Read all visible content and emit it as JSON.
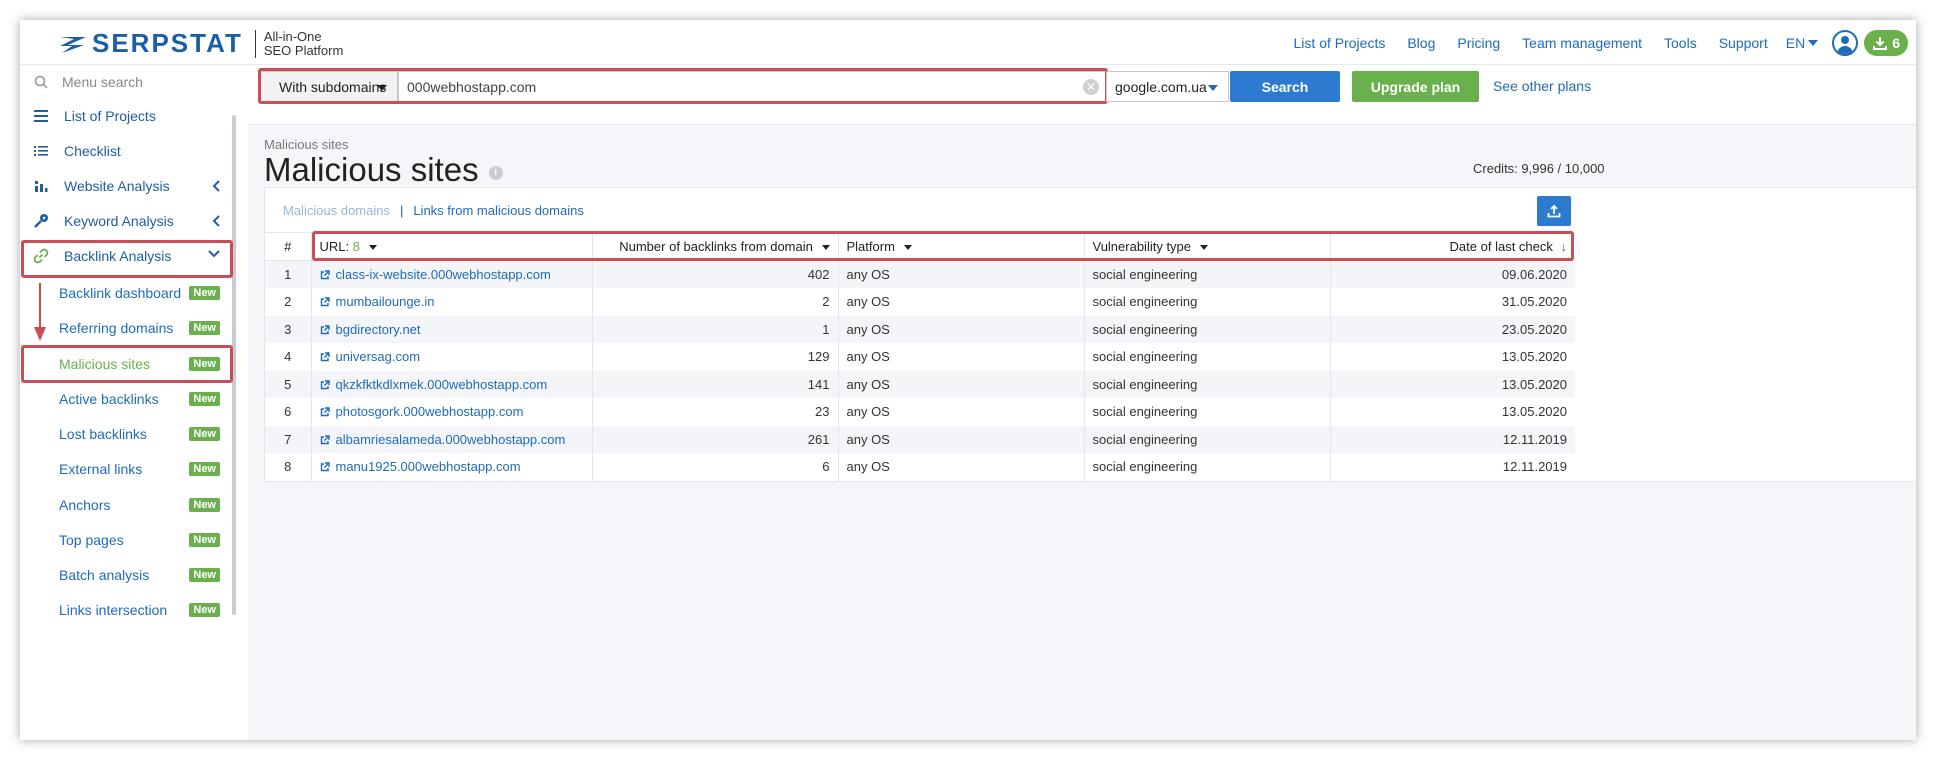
{
  "header": {
    "logo_text": "SERPSTAT",
    "tagline_1": "All-in-One",
    "tagline_2": "SEO Platform",
    "nav": [
      "List of Projects",
      "Blog",
      "Pricing",
      "Team management",
      "Tools",
      "Support"
    ],
    "lang": "EN",
    "downloads_count": "6"
  },
  "sidebar": {
    "search_placeholder": "Menu search",
    "items": [
      {
        "label": "List of Projects"
      },
      {
        "label": "Checklist"
      },
      {
        "label": "Website Analysis"
      },
      {
        "label": "Keyword Analysis"
      },
      {
        "label": "Backlink Analysis"
      }
    ],
    "sub_items": [
      {
        "label": "Backlink dashboard",
        "badge": "New"
      },
      {
        "label": "Referring domains",
        "badge": "New"
      },
      {
        "label": "Malicious sites",
        "badge": "New"
      },
      {
        "label": "Active backlinks",
        "badge": "New"
      },
      {
        "label": "Lost backlinks",
        "badge": "New"
      },
      {
        "label": "External links",
        "badge": "New"
      },
      {
        "label": "Anchors",
        "badge": "New"
      },
      {
        "label": "Top pages",
        "badge": "New"
      },
      {
        "label": "Batch analysis",
        "badge": "New"
      },
      {
        "label": "Links intersection",
        "badge": "New"
      }
    ]
  },
  "search": {
    "scope": "With subdomains",
    "domain": "000webhostapp.com",
    "database": "google.com.ua",
    "search_label": "Search",
    "upgrade_label": "Upgrade plan",
    "see_plans": "See other plans"
  },
  "page": {
    "breadcrumb": "Malicious sites",
    "title": "Malicious sites",
    "credits": "Credits: 9,996 / 10,000"
  },
  "tabs": {
    "malicious_domains": "Malicious domains",
    "separator": "|",
    "links_from": "Links from malicious domains"
  },
  "table": {
    "headers": {
      "index": "#",
      "url": "URL:",
      "url_count": "8",
      "backlinks": "Number of backlinks from domain",
      "platform": "Platform",
      "vulnerability": "Vulnerability type",
      "date": "Date of last check"
    },
    "rows": [
      {
        "n": "1",
        "url": "class-ix-website.000webhostapp.com",
        "backlinks": "402",
        "platform": "any OS",
        "type": "social engineering",
        "date": "09.06.2020"
      },
      {
        "n": "2",
        "url": "mumbailounge.in",
        "backlinks": "2",
        "platform": "any OS",
        "type": "social engineering",
        "date": "31.05.2020"
      },
      {
        "n": "3",
        "url": "bgdirectory.net",
        "backlinks": "1",
        "platform": "any OS",
        "type": "social engineering",
        "date": "23.05.2020"
      },
      {
        "n": "4",
        "url": "universag.com",
        "backlinks": "129",
        "platform": "any OS",
        "type": "social engineering",
        "date": "13.05.2020"
      },
      {
        "n": "5",
        "url": "qkzkfktkdlxmek.000webhostapp.com",
        "backlinks": "141",
        "platform": "any OS",
        "type": "social engineering",
        "date": "13.05.2020"
      },
      {
        "n": "6",
        "url": "photosgork.000webhostapp.com",
        "backlinks": "23",
        "platform": "any OS",
        "type": "social engineering",
        "date": "13.05.2020"
      },
      {
        "n": "7",
        "url": "albamriesalameda.000webhostapp.com",
        "backlinks": "261",
        "platform": "any OS",
        "type": "social engineering",
        "date": "12.11.2019"
      },
      {
        "n": "8",
        "url": "manu1925.000webhostapp.com",
        "backlinks": "6",
        "platform": "any OS",
        "type": "social engineering",
        "date": "12.11.2019"
      }
    ]
  },
  "colors": {
    "brand_blue": "#1d5fa6",
    "link_blue": "#1f6bb8",
    "green": "#6ab04c",
    "highlight_red": "#c94e55"
  }
}
